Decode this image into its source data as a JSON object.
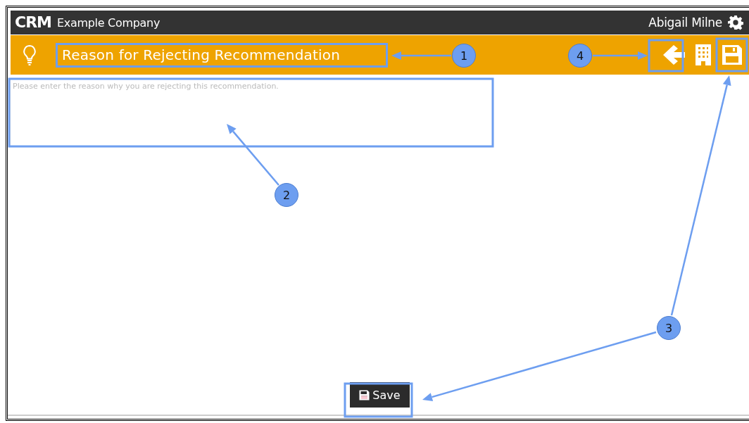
{
  "top_bar": {
    "logo": "CRM",
    "company": "Example Company",
    "user": "Abigail Milne"
  },
  "title_bar": {
    "title": "Reason for Rejecting Recommendation"
  },
  "reason_field": {
    "placeholder": "Please enter the reason why you are rejecting this recommendation."
  },
  "save_button": {
    "label": "Save"
  },
  "callouts": [
    {
      "number": "1"
    },
    {
      "number": "2"
    },
    {
      "number": "3"
    },
    {
      "number": "4"
    }
  ]
}
